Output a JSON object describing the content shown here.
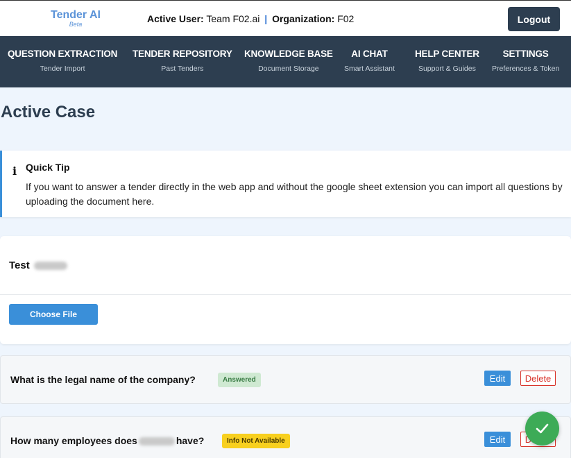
{
  "header": {
    "app_name": "Tender AI",
    "app_badge": "Beta",
    "active_user_label": "Active User:",
    "active_user_value": "Team F02.ai",
    "separator": "|",
    "organization_label": "Organization:",
    "organization_value": "F02",
    "logout_label": "Logout"
  },
  "nav": {
    "items": [
      {
        "title": "QUESTION EXTRACTION",
        "subtitle": "Tender Import"
      },
      {
        "title": "TENDER REPOSITORY",
        "subtitle": "Past Tenders"
      },
      {
        "title": "KNOWLEDGE BASE",
        "subtitle": "Document Storage"
      },
      {
        "title": "AI CHAT",
        "subtitle": "Smart Assistant"
      },
      {
        "title": "HELP CENTER",
        "subtitle": "Support & Guides"
      },
      {
        "title": "SETTINGS",
        "subtitle": "Preferences & Token"
      }
    ]
  },
  "page": {
    "title": "Active Case"
  },
  "tip": {
    "icon": "info-icon",
    "title": "Quick Tip",
    "text": "If you want to answer a tender directly in the web app and without the google sheet extension you can import all questions by uploading the document here."
  },
  "case": {
    "name": "Test",
    "choose_file_label": "Choose File"
  },
  "questions": [
    {
      "text": "What is the legal name of the company?",
      "status": "Answered",
      "edit_label": "Edit",
      "delete_label": "Delete"
    },
    {
      "text_before": "How many employees does",
      "text_after": "have?",
      "status": "Info Not Available",
      "edit_label": "Edit",
      "delete_label": "Delete"
    }
  ],
  "toast": {
    "icon": "checkmark-icon"
  },
  "colors": {
    "nav_bg": "#2d3e50",
    "accent": "#3a8fd9",
    "page_bg": "#eef5fd",
    "answered_bg": "#cfe9d2",
    "na_bg": "#f8d01f",
    "delete": "#d9342b",
    "success": "#3dab57"
  }
}
